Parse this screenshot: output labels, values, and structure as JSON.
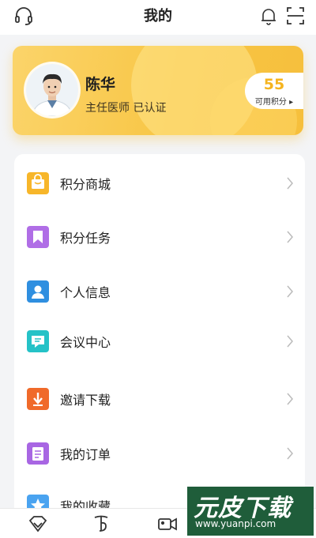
{
  "header": {
    "title": "我的"
  },
  "profile": {
    "name": "陈华",
    "title": "主任医师 已认证",
    "points_value": "55",
    "points_label": "可用积分 ▸"
  },
  "menu": {
    "items": [
      {
        "label": "积分商城",
        "icon": "mall-icon",
        "color": "#f7b62a"
      },
      {
        "label": "积分任务",
        "icon": "bookmark-icon",
        "color": "#b06ee6"
      },
      {
        "label": "个人信息",
        "icon": "person-icon",
        "color": "#2f8fe0"
      },
      {
        "label": "会议中心",
        "icon": "chat-icon",
        "color": "#25c2c7"
      },
      {
        "label": "邀请下载",
        "icon": "download-icon",
        "color": "#f06a2a"
      },
      {
        "label": "我的订单",
        "icon": "order-icon",
        "color": "#a866e3"
      },
      {
        "label": "我的收藏",
        "icon": "star-icon",
        "color": "#4aa3f0"
      }
    ]
  },
  "tabbar": {
    "tabs": [
      {
        "icon": "diamond-icon"
      },
      {
        "icon": "brand-icon"
      },
      {
        "icon": "video-icon"
      }
    ]
  },
  "watermark": {
    "big": "元皮下载",
    "small": "www.yuanpi.com"
  },
  "colors": {
    "accent": "#f8c646",
    "points": "#f5b41f"
  }
}
